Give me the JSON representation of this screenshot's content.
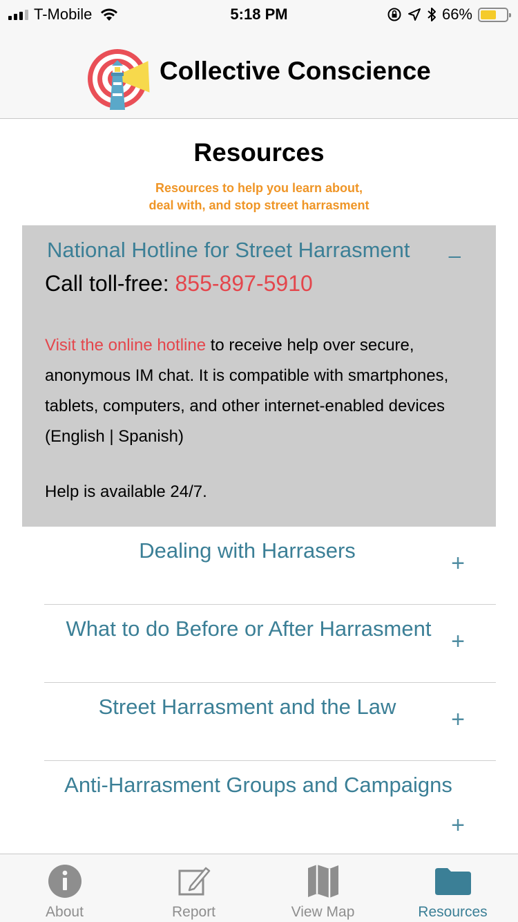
{
  "status_bar": {
    "carrier": "T-Mobile",
    "time": "5:18 PM",
    "battery": "66%",
    "battery_level": 0.66
  },
  "app": {
    "title": "Collective Conscience"
  },
  "page": {
    "title": "Resources",
    "subtitle_line1": "Resources to help you learn about,",
    "subtitle_line2": "deal with, and stop street harrasment"
  },
  "hotline": {
    "title": "National Hotline for Street Harrasment",
    "collapse_symbol": "_",
    "call_label": "Call toll-free: ",
    "phone": "855-897-5910",
    "link_text": "Visit the online hotline",
    "body_text": " to receive help over secure, anonymous IM chat. It is compatible with smartphones, tablets, computers, and other internet-enabled devices (English | Spanish)",
    "availability": "Help is available 24/7."
  },
  "sections": [
    {
      "title": "Dealing with Harrasers",
      "expand_symbol": "+"
    },
    {
      "title": "What to do Before or After Harrasment",
      "expand_symbol": "+"
    },
    {
      "title": "Street Harrasment and the Law",
      "expand_symbol": "+"
    },
    {
      "title": "Anti-Harrasment Groups and Campaigns",
      "expand_symbol": "+"
    }
  ],
  "tabs": [
    {
      "label": "About",
      "icon": "info-icon"
    },
    {
      "label": "Report",
      "icon": "edit-icon"
    },
    {
      "label": "View Map",
      "icon": "map-icon"
    },
    {
      "label": "Resources",
      "icon": "folder-icon",
      "active": true
    }
  ],
  "colors": {
    "accent": "#3b7f96",
    "subtitle": "#ef9526",
    "link": "#e4464c",
    "card_bg": "#cccccc"
  }
}
